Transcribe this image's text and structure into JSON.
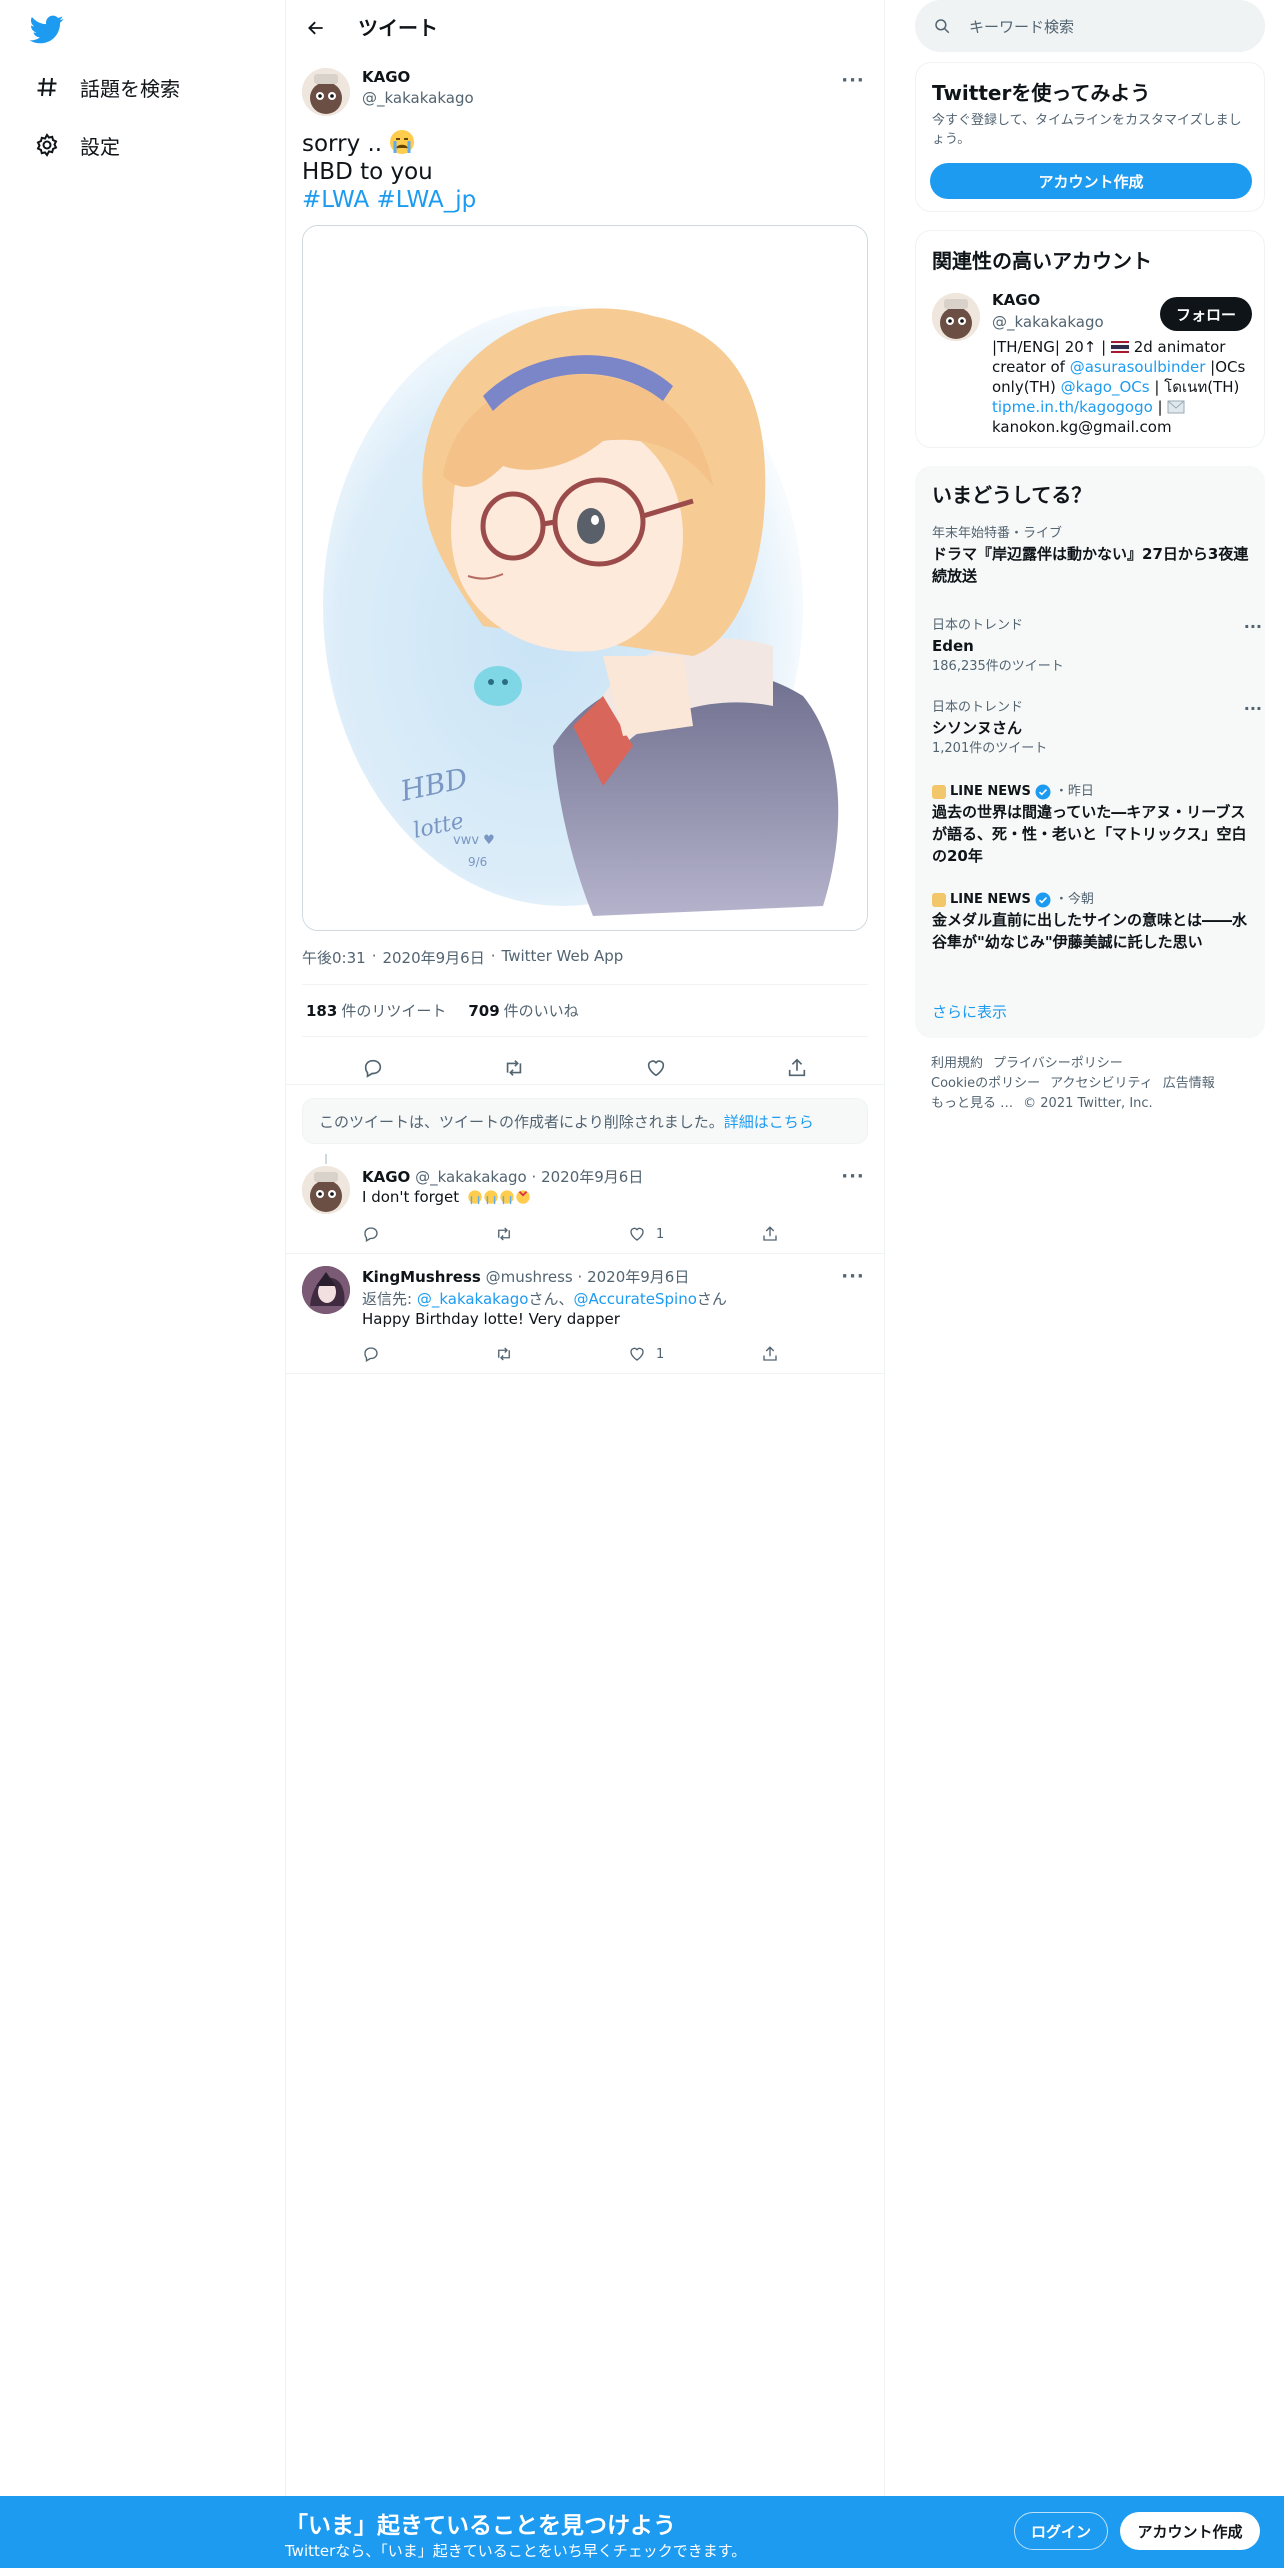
{
  "colors": {
    "accent": "#1d9bf0",
    "text": "#0f1419",
    "muted": "#536471",
    "border": "#eff3f4"
  },
  "nav": {
    "logo": "twitter-bird-icon",
    "items": [
      {
        "label": "話題を検索",
        "icon": "hashtag-icon"
      },
      {
        "label": "設定",
        "icon": "gear-icon"
      }
    ]
  },
  "header": {
    "title": "ツイート"
  },
  "tweet": {
    "name": "KAGO",
    "handle": "@_kakakakago",
    "line1": "sorry .. ",
    "line2": "HBD to you",
    "hashtags": [
      "#LWA",
      "#LWA_jp"
    ],
    "image_alt": "Illustration: smiling character with glasses and a headband, text 'HBD lotte'",
    "image_text": [
      "HBD",
      "lotte",
      "vwv ♥",
      "9/6"
    ],
    "time": "午後0:31",
    "date": "2020年9月6日",
    "source": "Twitter Web App",
    "retweets_count": "183",
    "retweets_label": "件のリツイート",
    "likes_count": "709",
    "likes_label": "件のいいね"
  },
  "deleted_notice": {
    "text": "このツイートは、ツイートの作成者により削除されました。",
    "link": "詳細はこちら"
  },
  "replies": [
    {
      "name": "KAGO",
      "handle": "@_kakakakago",
      "date": "2020年9月6日",
      "text": "I don't forget ",
      "reply_count": "",
      "retweet_count": "",
      "like_count": "1"
    },
    {
      "name": "KingMushress",
      "handle": "@mushress",
      "date": "2020年9月6日",
      "reply_to_label": "返信先: ",
      "reply_to_1": "@_kakakakago",
      "reply_to_suffix_1": "さん、",
      "reply_to_2": "@AccurateSpino",
      "reply_to_suffix_2": "さん",
      "text": "Happy Birthday lotte! Very dapper",
      "like_count": "1"
    }
  ],
  "search": {
    "placeholder": "キーワード検索"
  },
  "signup_card": {
    "title": "Twitterを使ってみよう",
    "subtitle": "今すぐ登録して、タイムラインをカスタマイズしましょう。",
    "button": "アカウント作成"
  },
  "related": {
    "title": "関連性の高いアカウント",
    "name": "KAGO",
    "handle": "@_kakakakago",
    "follow_label": "フォロー",
    "bio_1": "|TH/ENG| 20↑ | ",
    "bio_2": " 2d animator creator of ",
    "bio_link_1": "@asurasoulbinder",
    "bio_3": " |OCs only(TH) ",
    "bio_link_2": "@kago_OCs",
    "bio_4": " | โดเนท(TH) ",
    "bio_link_3": "tipme.in.th/kagogogo",
    "bio_5": " | ",
    "bio_6": " kanokon.kg@gmail.com"
  },
  "trends": {
    "title": "いまどうしてる？",
    "items": [
      {
        "context": "年末年始特番・ライブ",
        "title": "ドラマ『岸辺露伴は動かない』27日から3夜連続放送",
        "count": ""
      },
      {
        "context": "日本のトレンド",
        "title": "Eden",
        "count": "186,235件のツイート"
      },
      {
        "context": "日本のトレンド",
        "title": "シソンヌさん",
        "count": "1,201件のツイート"
      },
      {
        "context": "LINE NEWS",
        "time": "・昨日",
        "title": "過去の世界は間違っていた―キアヌ・リーブスが語る、死・性・老いと「マトリックス」空白の20年",
        "count": ""
      },
      {
        "context": "LINE NEWS",
        "time": "・今朝",
        "title": "金メダル直前に出したサインの意味とは――水谷隼が\"幼なじみ\"伊藤美誠に託した思い",
        "count": ""
      }
    ],
    "show_more": "さらに表示"
  },
  "footer": {
    "links": [
      "利用規約",
      "プライバシーポリシー",
      "Cookieのポリシー",
      "アクセシビリティ",
      "広告情報",
      "もっと見る …"
    ],
    "copyright": "© 2021 Twitter, Inc."
  },
  "bottom_bar": {
    "title": "「いま」起きていることを見つけよう",
    "subtitle": "Twitterなら、「いま」起きていることをいち早くチェックできます。",
    "login": "ログイン",
    "signup": "アカウント作成"
  }
}
